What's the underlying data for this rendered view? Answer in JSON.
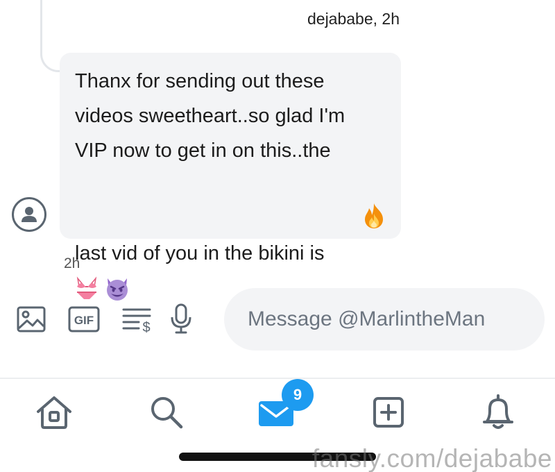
{
  "thread": {
    "reply_meta": "dejababe, 2h"
  },
  "message": {
    "text": "Thanx for sending out these\nvideos sweetheart..so glad I'm\nVIP now to get in on this..the\nlast vid of you in the bikini is",
    "emojis": [
      "fire-emoji",
      "bikini-emoji",
      "smiling-imp-emoji"
    ],
    "timestamp": "2h"
  },
  "composer": {
    "gif_label": "GIF",
    "placeholder": "Message @MarlintheMan",
    "value": "",
    "icons": [
      "image-icon",
      "gif-icon",
      "tip-icon",
      "microphone-icon"
    ]
  },
  "nav": {
    "items": [
      "home",
      "search",
      "messages",
      "create",
      "notifications"
    ],
    "messages_badge": "9",
    "active": "messages"
  },
  "watermark": "fansly.com/dejababe",
  "colors": {
    "accent": "#1d9bf0",
    "bubble": "#f3f4f6",
    "icon": "#5a6570"
  }
}
